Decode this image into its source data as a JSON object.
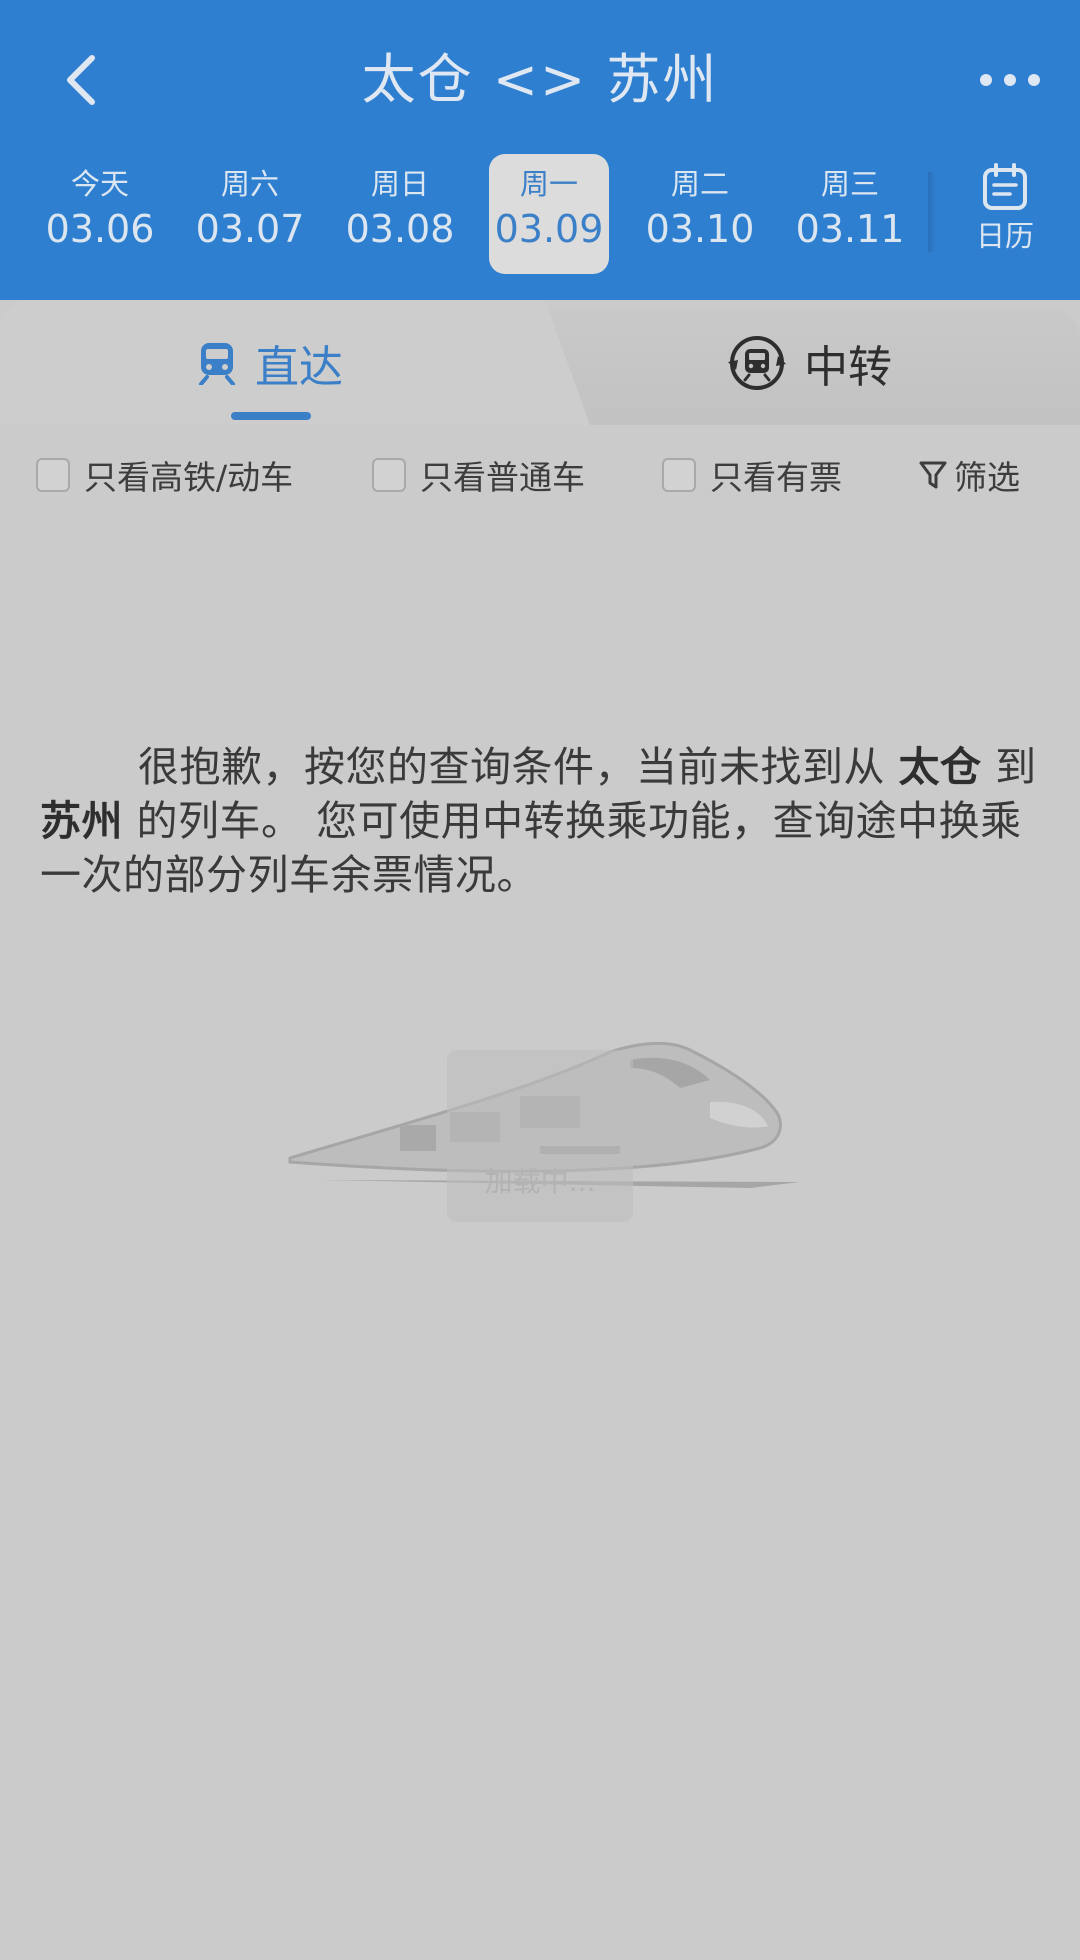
{
  "header": {
    "title": "太仓 <> 苏州",
    "back_icon": "chevron-left-icon",
    "more_icon": "more-dots-icon"
  },
  "dates": [
    {
      "dow": "今天",
      "md": "03.06",
      "active": false
    },
    {
      "dow": "周六",
      "md": "03.07",
      "active": false
    },
    {
      "dow": "周日",
      "md": "03.08",
      "active": false
    },
    {
      "dow": "周一",
      "md": "03.09",
      "active": true
    },
    {
      "dow": "周二",
      "md": "03.10",
      "active": false
    },
    {
      "dow": "周三",
      "md": "03.11",
      "active": false
    }
  ],
  "calendar": {
    "label": "日历",
    "icon": "calendar-icon"
  },
  "tabs": {
    "direct": {
      "label": "直达",
      "icon": "train-icon",
      "active": true
    },
    "transfer": {
      "label": "中转",
      "icon": "transfer-train-icon",
      "active": false
    }
  },
  "filters": {
    "high_speed": "只看高铁/动车",
    "normal": "只看普通车",
    "available": "只看有票",
    "filter_label": "筛选"
  },
  "message": {
    "part1": "很抱歉，按您的查询条件，当前未找到从 ",
    "from": "太仓",
    "part2": " 到 ",
    "to": "苏州",
    "part3": " 的列车。 您可使用中转换乘功能，查询途中换乘一次的部分列车余票情况。"
  },
  "loading_text": "加载中...",
  "colors": {
    "header_bg": "#2f7fd0",
    "accent": "#3a7fc8",
    "overlay_bg": "#cbcbcb"
  }
}
